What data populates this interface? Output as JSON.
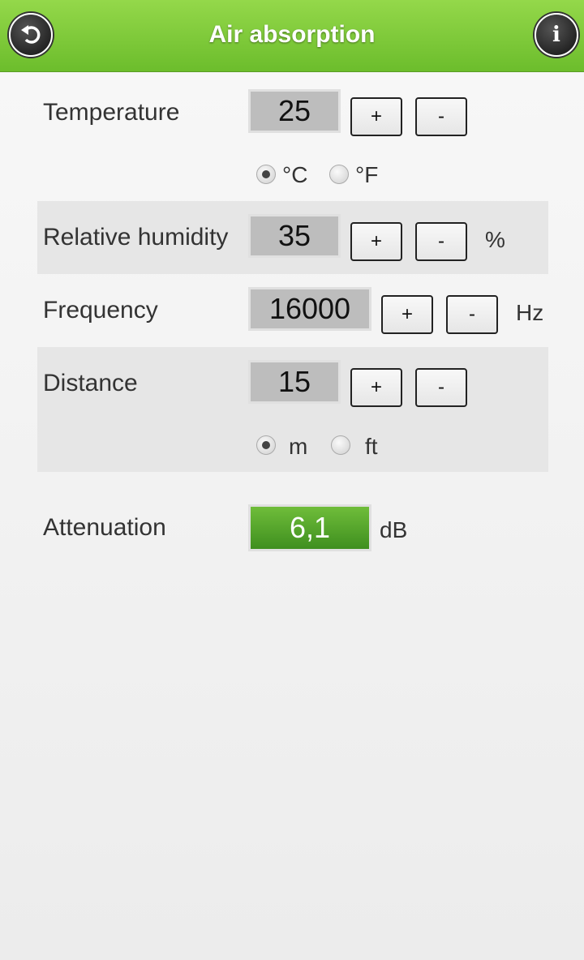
{
  "header": {
    "title": "Air absorption",
    "back_icon": "back-arrow-icon",
    "info_icon": "info-icon",
    "info_glyph": "i"
  },
  "temperature": {
    "label": "Temperature",
    "value": "25",
    "plus": "+",
    "minus": "-",
    "units": [
      {
        "label": "°C",
        "selected": true
      },
      {
        "label": "°F",
        "selected": false
      }
    ]
  },
  "humidity": {
    "label": "Relative humidity",
    "value": "35",
    "plus": "+",
    "minus": "-",
    "unit": "%"
  },
  "frequency": {
    "label": "Frequency",
    "value": "16000",
    "plus": "+",
    "minus": "-",
    "unit": "Hz"
  },
  "distance": {
    "label": "Distance",
    "value": "15",
    "plus": "+",
    "minus": "-",
    "units": [
      {
        "label": "m",
        "selected": true
      },
      {
        "label": "ft",
        "selected": false
      }
    ]
  },
  "attenuation": {
    "label": "Attenuation",
    "value": "6,1",
    "unit": "dB"
  },
  "colors": {
    "header_top": "#94d84a",
    "header_bottom": "#6cbd2c",
    "result_green": "#3f8f1f"
  }
}
